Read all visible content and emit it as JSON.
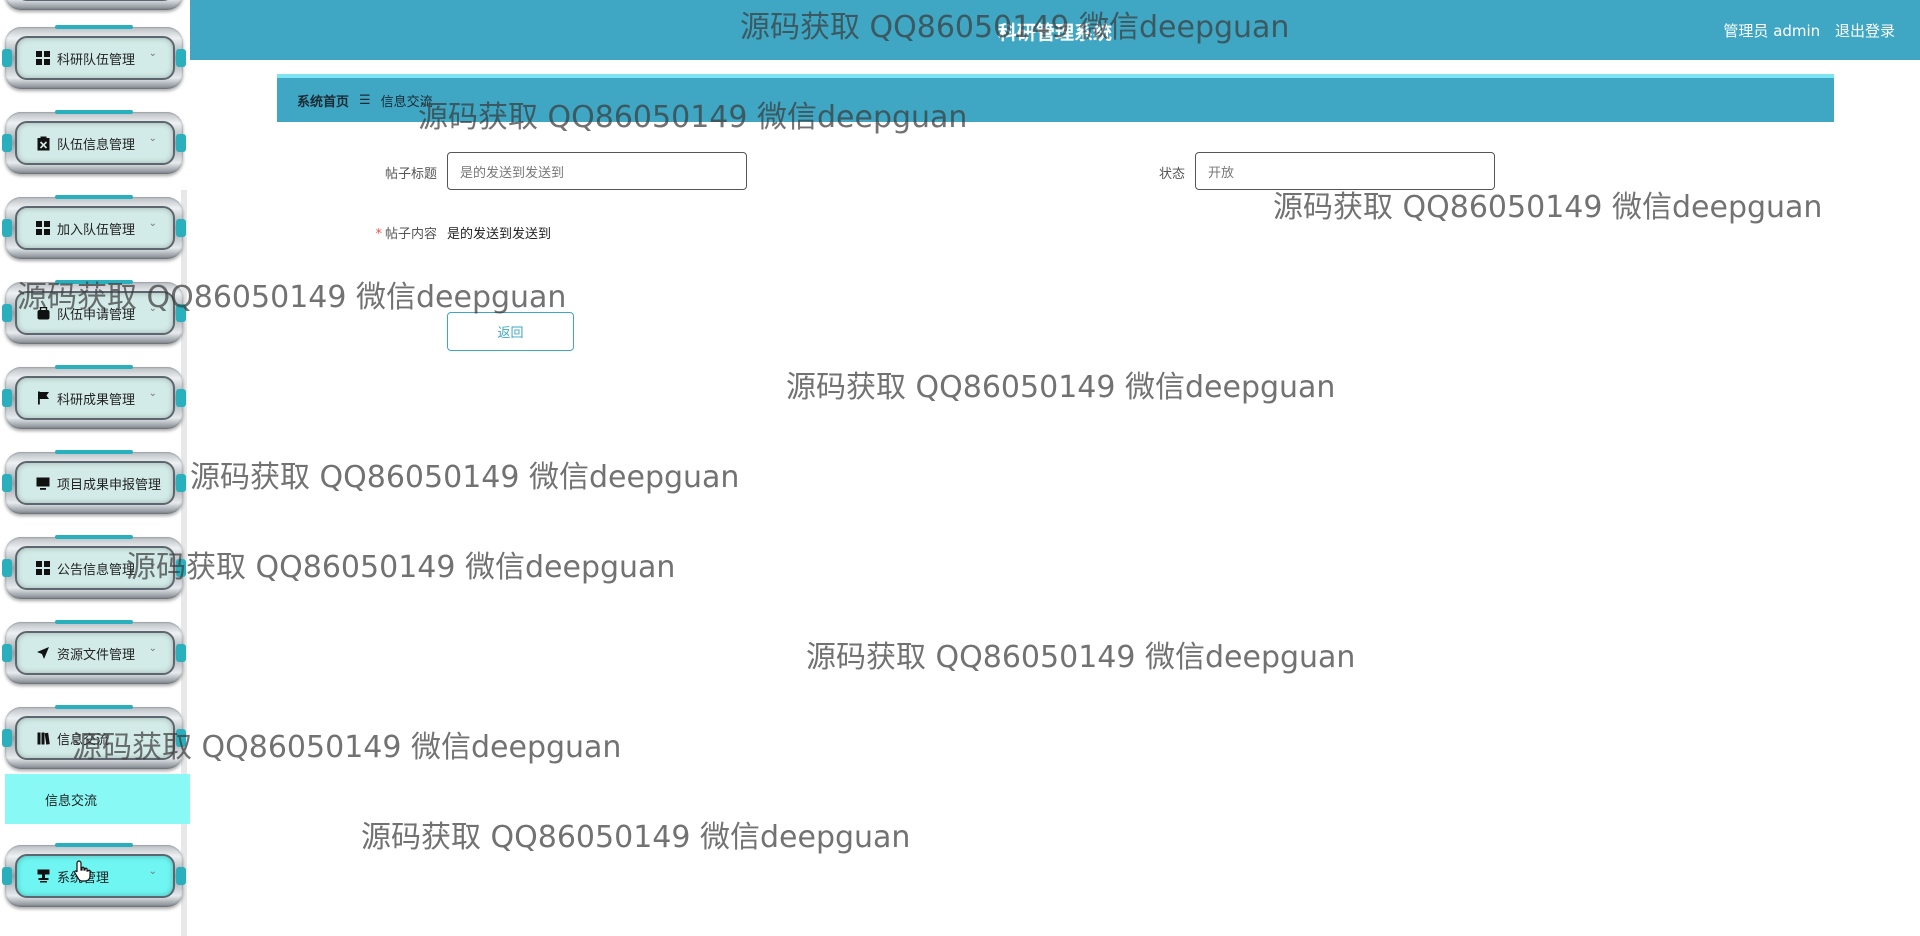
{
  "header": {
    "title": "科研管理系统",
    "user_label": "管理员 admin",
    "logout_label": "退出登录"
  },
  "breadcrumb": {
    "home": "系统首页",
    "separator": "☰",
    "current": "信息交流"
  },
  "form": {
    "title_label": "帖子标题",
    "title_value": "是的发送到发送到",
    "status_label": "状态",
    "status_value": "开放",
    "content_required_mark": "*",
    "content_label": "帖子内容",
    "content_value": "是的发送到发送到",
    "back_button": "返回"
  },
  "sidebar": {
    "items": [
      {
        "label": "科研队伍管理",
        "icon": "grid-icon"
      },
      {
        "label": "队伍信息管理",
        "icon": "clipboard-x-icon"
      },
      {
        "label": "加入队伍管理",
        "icon": "grid-icon"
      },
      {
        "label": "队伍申请管理",
        "icon": "bag-icon"
      },
      {
        "label": "科研成果管理",
        "icon": "flag-icon"
      },
      {
        "label": "项目成果申报管理",
        "icon": "monitor-icon"
      },
      {
        "label": "公告信息管理",
        "icon": "grid-icon"
      },
      {
        "label": "资源文件管理",
        "icon": "send-icon"
      },
      {
        "label": "信息交流",
        "icon": "book-icon"
      },
      {
        "label": "系统管理",
        "icon": "stamp-icon"
      }
    ],
    "submenu_active": "信息交流",
    "chevron": "⌄"
  },
  "watermark": "源码获取 QQ86050149 微信deepguan",
  "colors": {
    "primary": "#3fa7c4",
    "menu_active": "#88f9f5",
    "menu_inner": "#d3ebe8"
  }
}
